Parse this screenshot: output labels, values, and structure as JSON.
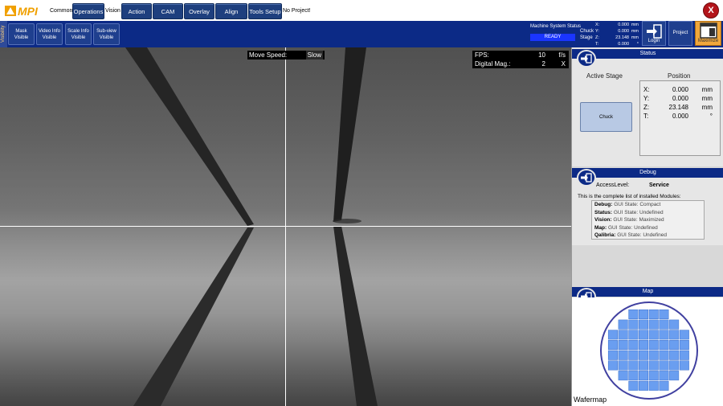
{
  "app": {
    "logo_text": "MPI"
  },
  "menu": {
    "common": "Common",
    "operations": "Operations",
    "vision": "Vision",
    "action": "Action",
    "cam": "CAM",
    "overlay": "Overlay",
    "align": "Align",
    "tools_setup": "Tools Setup",
    "project_status": "No Project!",
    "close": "X"
  },
  "toolbar": {
    "visibility_label": "Visibility",
    "buttons": [
      {
        "label": "Mask",
        "state": "Visible"
      },
      {
        "label": "Video Info",
        "state": "Visible"
      },
      {
        "label": "Scale Info",
        "state": "Visible"
      },
      {
        "label": "Sub-view",
        "state": "Visible"
      }
    ],
    "machine_status_title": "Machine System Status",
    "machine_status": "READY",
    "stage_lines": [
      "Chuck",
      "Stage"
    ],
    "coords": [
      {
        "axis": "X:",
        "value": "0.000",
        "unit": "mm"
      },
      {
        "axis": "Y:",
        "value": "0.000",
        "unit": "mm"
      },
      {
        "axis": "Z:",
        "value": "23.148",
        "unit": "mm"
      },
      {
        "axis": "T:",
        "value": "0.000",
        "unit": "°"
      }
    ],
    "login": "Login",
    "project": "Project",
    "maximize": "Maximize"
  },
  "camera": {
    "move_speed_label": "Move Speed:",
    "move_speed_value": "Slow",
    "fps_label": "FPS:",
    "fps_value": "10",
    "fps_unit": "f/s",
    "mag_label": "Digital Mag.:",
    "mag_value": "2",
    "mag_unit": "X"
  },
  "status_panel": {
    "title": "Status",
    "active_stage_label": "Active Stage",
    "position_label": "Position",
    "stage_button": "Chuck",
    "position": [
      {
        "axis": "X:",
        "value": "0.000",
        "unit": "mm"
      },
      {
        "axis": "Y:",
        "value": "0.000",
        "unit": "mm"
      },
      {
        "axis": "Z:",
        "value": "23.148",
        "unit": "mm"
      },
      {
        "axis": "T:",
        "value": "0.000",
        "unit": "°"
      }
    ]
  },
  "debug_panel": {
    "title": "Debug",
    "access_level_label": "AccessLevel:",
    "access_level_value": "Service",
    "modules_intro": "This is the complete list of installed Modules:",
    "modules": [
      {
        "name": "Debug:",
        "state": "GUI State: Compact"
      },
      {
        "name": "Status:",
        "state": "GUI State: Undefined"
      },
      {
        "name": "Vision:",
        "state": "GUI State: Maximized"
      },
      {
        "name": "Map:",
        "state": "GUI State: Undefined"
      },
      {
        "name": "Qalibria:",
        "state": "GUI State: Undefined"
      }
    ]
  },
  "map_panel": {
    "title": "Map",
    "label": "Wafermap"
  },
  "colors": {
    "menu_blue": "#1e3f7e",
    "toolbar_blue": "#0c2a86",
    "ready_blue": "#1a35ff",
    "maximize_orange": "#f0a73c",
    "close_red": "#b3141a",
    "die_blue": "#6a9ef0"
  },
  "icons": [
    "mpi-logo-icon",
    "close-icon",
    "login-icon",
    "maximize-icon",
    "panel-toggle-icon"
  ]
}
